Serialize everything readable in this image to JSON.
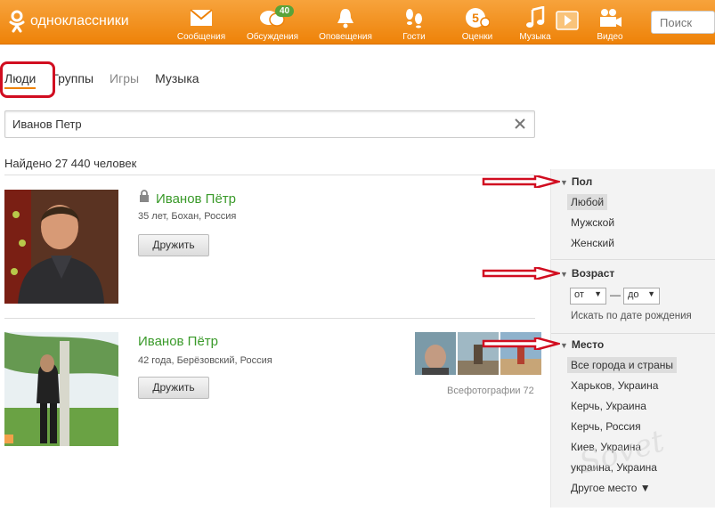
{
  "header": {
    "logo_text": "одноклассники",
    "nav": [
      {
        "label": "Сообщения",
        "icon": "envelope-icon"
      },
      {
        "label": "Обсуждения",
        "icon": "discussion-icon",
        "badge": "40"
      },
      {
        "label": "Оповещения",
        "icon": "bell-icon"
      },
      {
        "label": "Гости",
        "icon": "footprints-icon"
      },
      {
        "label": "Оценки",
        "icon": "rating-icon"
      },
      {
        "label": "Музыка",
        "icon": "music-note-icon"
      },
      {
        "label": "Видео",
        "icon": "video-camera-icon"
      }
    ],
    "search_placeholder": "Поиск"
  },
  "tabs": [
    "Люди",
    "Группы",
    "Игры",
    "Музыка"
  ],
  "query": {
    "value": "Иванов Петр"
  },
  "found_text": "Найдено 27 440 человек",
  "results": [
    {
      "name": "Иванов Пётр",
      "info": "35 лет, Бохан, Россия",
      "button": "Дружить",
      "locked": true
    },
    {
      "name": "Иванов Пётр",
      "info": "42 года, Берёзовский, Россия",
      "button": "Дружить",
      "locked": false,
      "all_photos": "Всефотографии 72"
    }
  ],
  "filters": {
    "gender": {
      "title": "Пол",
      "options": [
        "Любой",
        "Мужской",
        "Женский"
      ],
      "selected": "Любой"
    },
    "age": {
      "title": "Возраст",
      "from": "от",
      "to": "до",
      "dash": "—",
      "birthday_link": "Искать по дате рождения"
    },
    "place": {
      "title": "Место",
      "options": [
        "Все города и страны",
        "Харьков, Украина",
        "Керчь, Украина",
        "Керчь, Россия",
        "Киев, Украина",
        "украина, Украина"
      ],
      "selected": "Все города и страны",
      "more": "Другое место ▼"
    }
  },
  "watermark": "Sovet",
  "colors": {
    "brand": "#ee8208",
    "name_green": "#3a9a2a",
    "annotation_red": "#d10d20",
    "badge_green": "#59a33a"
  }
}
